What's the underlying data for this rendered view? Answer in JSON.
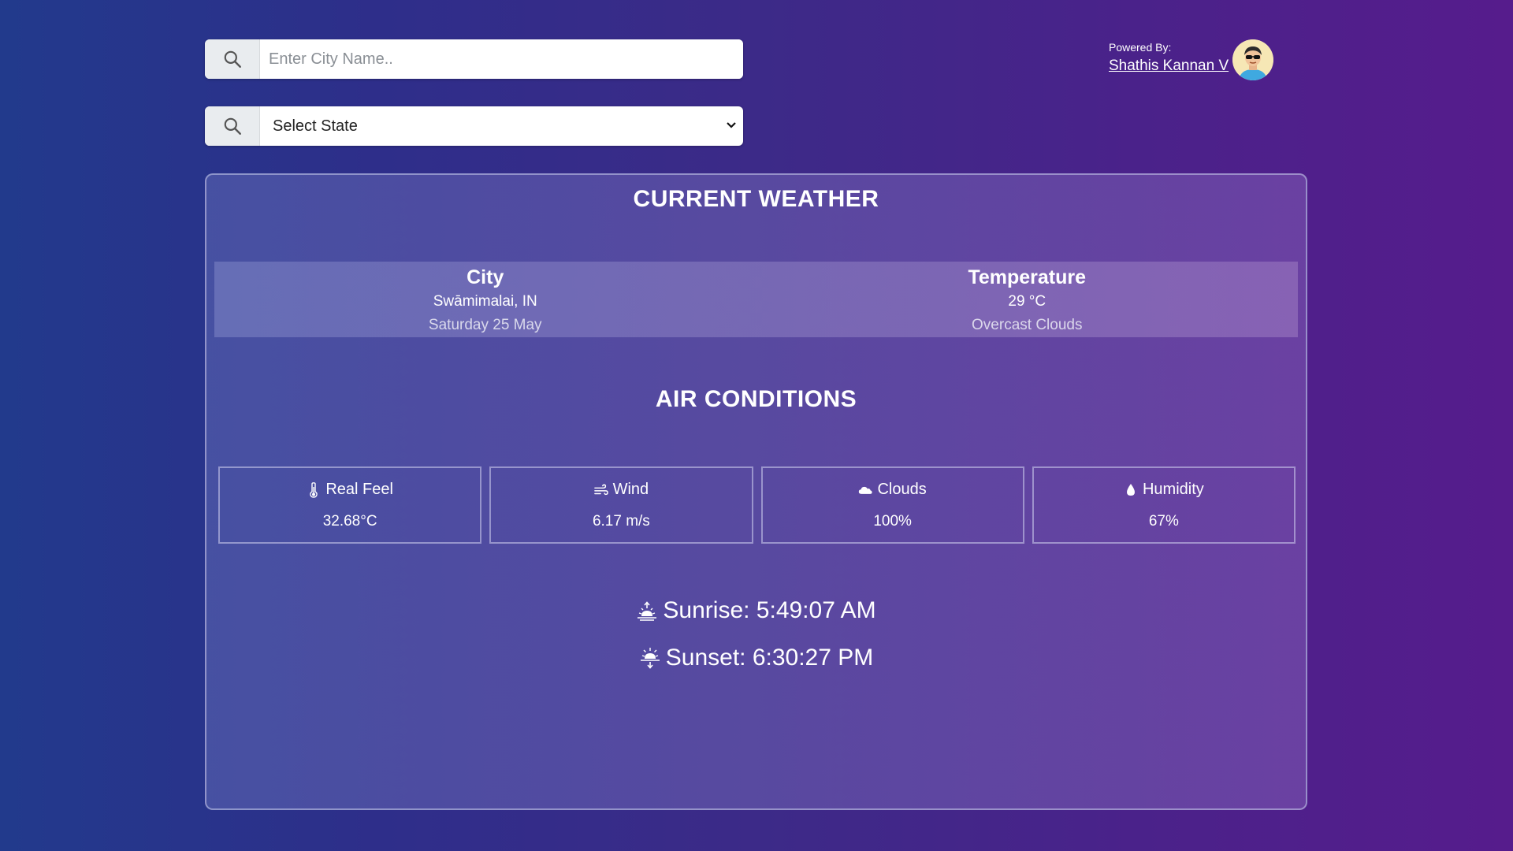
{
  "search": {
    "city_placeholder": "Enter City Name..",
    "state_selected": "Select State"
  },
  "author": {
    "powered_label": "Powered By:",
    "name": "Shathis Kannan V"
  },
  "current": {
    "title": "CURRENT WEATHER",
    "city_header": "City",
    "city_value": "Swāmimalai, IN",
    "date": "Saturday 25 May",
    "temp_header": "Temperature",
    "temp_value": "29 °C",
    "description": "Overcast Clouds"
  },
  "air": {
    "title": "AIR CONDITIONS",
    "items": [
      {
        "label": "Real Feel",
        "value": "32.68°C",
        "icon": "thermometer-icon"
      },
      {
        "label": "Wind",
        "value": "6.17 m/s",
        "icon": "wind-icon"
      },
      {
        "label": "Clouds",
        "value": "100%",
        "icon": "cloud-icon"
      },
      {
        "label": "Humidity",
        "value": "67%",
        "icon": "droplet-icon"
      }
    ]
  },
  "sun": {
    "sunrise": "Sunrise: 5:49:07 AM",
    "sunset": "Sunset: 6:30:27 PM"
  },
  "colors": {
    "bg_left": "#223a8c",
    "bg_right": "#561c8c"
  }
}
